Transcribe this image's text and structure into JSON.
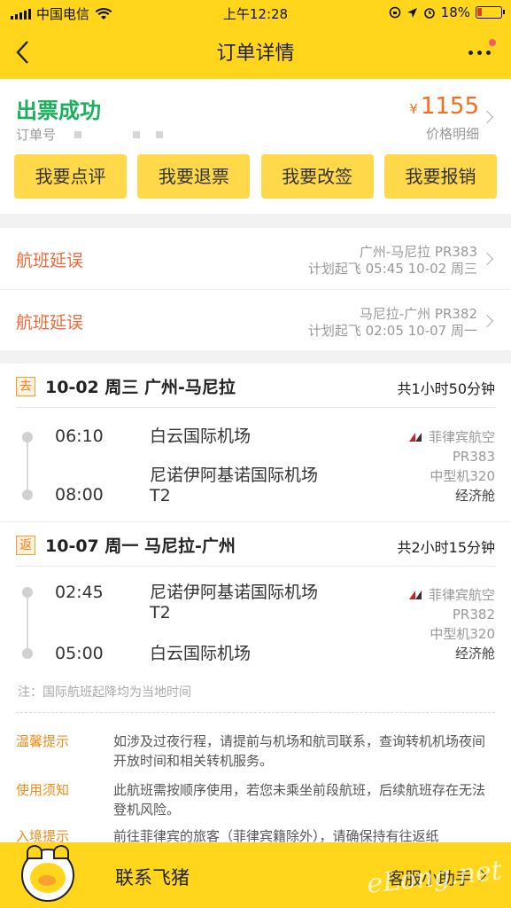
{
  "status": {
    "carrier": "中国电信",
    "time": "上午12:28",
    "battery": "18%",
    "battery_level": 0.18
  },
  "nav": {
    "title": "订单详情"
  },
  "order": {
    "status": "出票成功",
    "order_no_label": "订单号",
    "currency": "¥",
    "price": "1155",
    "price_detail": "价格明细"
  },
  "actions": [
    "我要点评",
    "我要退票",
    "我要改签",
    "我要报销"
  ],
  "delays": [
    {
      "label": "航班延误",
      "route": "广州-马尼拉 PR383",
      "plan": "计划起飞 05:45 10-02 周三"
    },
    {
      "label": "航班延误",
      "route": "马尼拉-广州 PR382",
      "plan": "计划起飞 02:05 10-07 周一"
    }
  ],
  "segments": [
    {
      "tag": "去",
      "route": "10-02 周三 广州-马尼拉",
      "duration": "共1小时50分钟",
      "dep_time": "06:10",
      "dep_airport": "白云国际机场",
      "arr_time": "08:00",
      "arr_airport": "尼诺伊阿基诺国际机场",
      "arr_terminal": "T2",
      "airline": "菲律宾航空",
      "flight": "PR383",
      "aircraft": "中型机320",
      "cabin": "经济舱"
    },
    {
      "tag": "返",
      "route": "10-07 周一 马尼拉-广州",
      "duration": "共2小时15分钟",
      "dep_time": "02:45",
      "dep_airport": "尼诺伊阿基诺国际机场",
      "dep_terminal": "T2",
      "arr_time": "05:00",
      "arr_airport": "白云国际机场",
      "airline": "菲律宾航空",
      "flight": "PR382",
      "aircraft": "中型机320",
      "cabin": "经济舱"
    }
  ],
  "note": "注：国际航班起降均为当地时间",
  "tips": [
    {
      "k": "温馨提示",
      "v": "如涉及过夜行程，请提前与机场和航司联系，查询转机机场夜间开放时间和相关转机服务。"
    },
    {
      "k": "使用须知",
      "v": "此航班需按顺序使用，若您未乘坐前段航班，后续航班存在无法登机风险。"
    },
    {
      "k": "入境提示",
      "v": "前往菲律宾的旅客（菲律宾籍除外），请确保持有往返纸"
    }
  ],
  "footer": {
    "contact": "联系飞猪",
    "helper": "客服小助手",
    "watermark": "eLong.net"
  }
}
